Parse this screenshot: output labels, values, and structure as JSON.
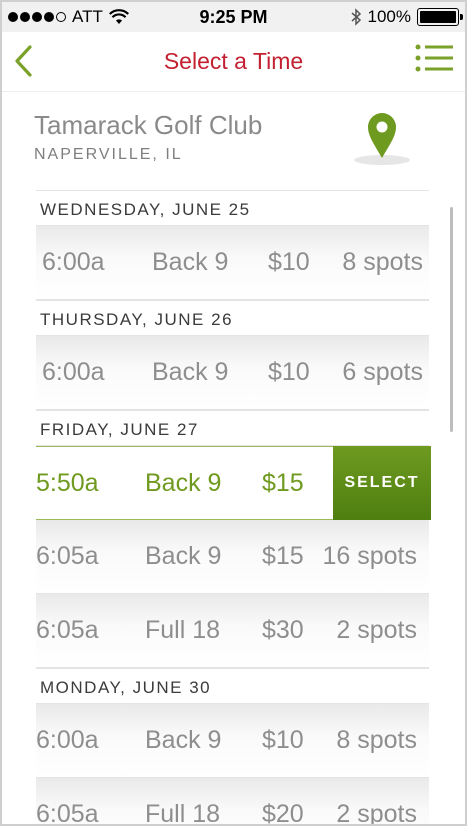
{
  "status_bar": {
    "carrier": "ATT",
    "time": "9:25 PM",
    "battery": "100%"
  },
  "nav": {
    "title": "Select a Time"
  },
  "course": {
    "name": "Tamarack Golf Club",
    "location": "NAPERVILLE, IL"
  },
  "colors": {
    "accent_green": "#6f9a1f",
    "title_red": "#c32031"
  },
  "icons": {
    "back": "chevron-left-icon",
    "menu": "list-menu-icon",
    "map": "map-pin-icon"
  },
  "days": [
    {
      "label": "WEDNESDAY, JUNE 25",
      "slots": [
        {
          "time": "6:00a",
          "holes": "Back 9",
          "price": "$10",
          "spots": "8 spots"
        }
      ]
    },
    {
      "label": "THURSDAY, JUNE 26",
      "slots": [
        {
          "time": "6:00a",
          "holes": "Back 9",
          "price": "$10",
          "spots": "6 spots"
        }
      ]
    },
    {
      "label": "FRIDAY, JUNE 27",
      "slots": [
        {
          "time": "5:50a",
          "holes": "Back 9",
          "price": "$15",
          "spots": "",
          "selected": true,
          "action": "SELECT"
        },
        {
          "time": "6:05a",
          "holes": "Back 9",
          "price": "$15",
          "spots": "16 spots"
        },
        {
          "time": "6:05a",
          "holes": "Full 18",
          "price": "$30",
          "spots": "2 spots"
        }
      ]
    },
    {
      "label": "MONDAY, JUNE 30",
      "slots": [
        {
          "time": "6:00a",
          "holes": "Back 9",
          "price": "$10",
          "spots": "8 spots"
        },
        {
          "time": "6:05a",
          "holes": "Full 18",
          "price": "$20",
          "spots": "2 spots"
        }
      ]
    }
  ]
}
